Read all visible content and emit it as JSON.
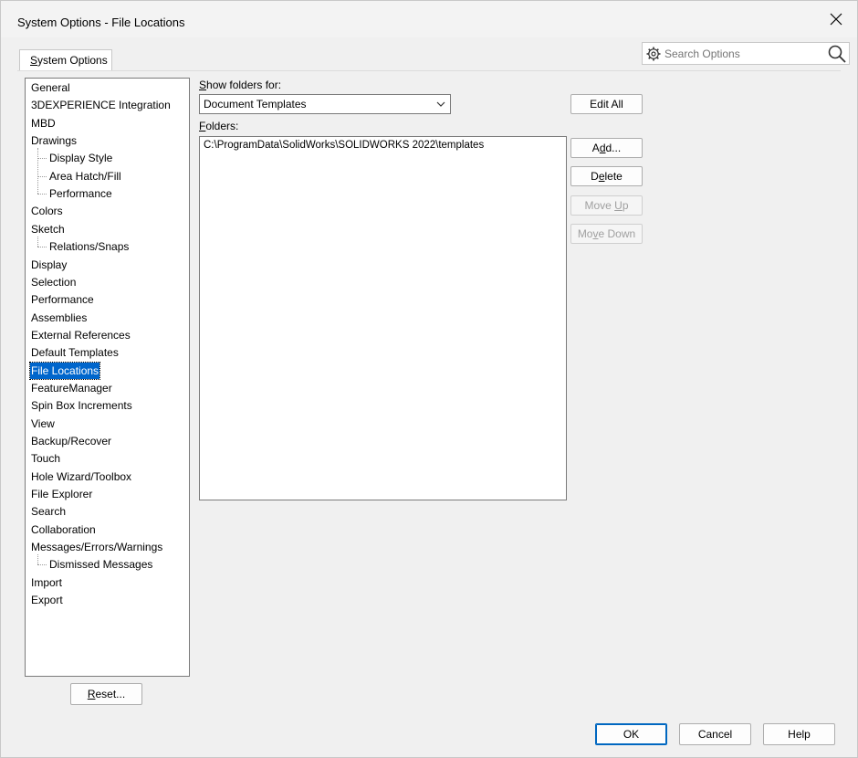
{
  "window": {
    "title": "System Options - File Locations"
  },
  "tabs": {
    "active_label_pre": "",
    "active_label_ul": "S",
    "active_label_post": "ystem Options"
  },
  "search": {
    "placeholder": "Search Options"
  },
  "tree": {
    "items": [
      {
        "label": "General",
        "indent": false
      },
      {
        "label": "3DEXPERIENCE Integration",
        "indent": false
      },
      {
        "label": "MBD",
        "indent": false
      },
      {
        "label": "Drawings",
        "indent": false
      },
      {
        "label": "Display Style",
        "indent": true
      },
      {
        "label": "Area Hatch/Fill",
        "indent": true
      },
      {
        "label": "Performance",
        "indent": true
      },
      {
        "label": "Colors",
        "indent": false
      },
      {
        "label": "Sketch",
        "indent": false
      },
      {
        "label": "Relations/Snaps",
        "indent": true
      },
      {
        "label": "Display",
        "indent": false
      },
      {
        "label": "Selection",
        "indent": false
      },
      {
        "label": "Performance",
        "indent": false
      },
      {
        "label": "Assemblies",
        "indent": false
      },
      {
        "label": "External References",
        "indent": false
      },
      {
        "label": "Default Templates",
        "indent": false
      },
      {
        "label": "File Locations",
        "indent": false,
        "selected": true
      },
      {
        "label": "FeatureManager",
        "indent": false
      },
      {
        "label": "Spin Box Increments",
        "indent": false
      },
      {
        "label": "View",
        "indent": false
      },
      {
        "label": "Backup/Recover",
        "indent": false
      },
      {
        "label": "Touch",
        "indent": false
      },
      {
        "label": "Hole Wizard/Toolbox",
        "indent": false
      },
      {
        "label": "File Explorer",
        "indent": false
      },
      {
        "label": "Search",
        "indent": false
      },
      {
        "label": "Collaboration",
        "indent": false
      },
      {
        "label": "Messages/Errors/Warnings",
        "indent": false
      },
      {
        "label": "Dismissed Messages",
        "indent": true
      },
      {
        "label": "Import",
        "indent": false
      },
      {
        "label": "Export",
        "indent": false
      }
    ]
  },
  "main": {
    "show_folders_label_ul": "S",
    "show_folders_label_rest": "how folders for:",
    "show_folders_value": "Document Templates",
    "folders_label_ul": "F",
    "folders_label_rest": "olders:",
    "folders": [
      "C:\\ProgramData\\SolidWorks\\SOLIDWORKS 2022\\templates"
    ]
  },
  "side_buttons": {
    "edit_all": "Edit All",
    "add_pre": "A",
    "add_ul": "d",
    "add_post": "d...",
    "delete_pre": "D",
    "delete_ul": "e",
    "delete_post": "lete",
    "move_up_pre": "Move ",
    "move_up_ul": "U",
    "move_up_post": "p",
    "move_down_pre": "Mo",
    "move_down_ul": "v",
    "move_down_post": "e Down"
  },
  "footer": {
    "reset_ul": "R",
    "reset_rest": "eset...",
    "ok": "OK",
    "cancel": "Cancel",
    "help": "Help"
  },
  "colors": {
    "selection": "#0066cc",
    "primary_border": "#0067c0"
  }
}
